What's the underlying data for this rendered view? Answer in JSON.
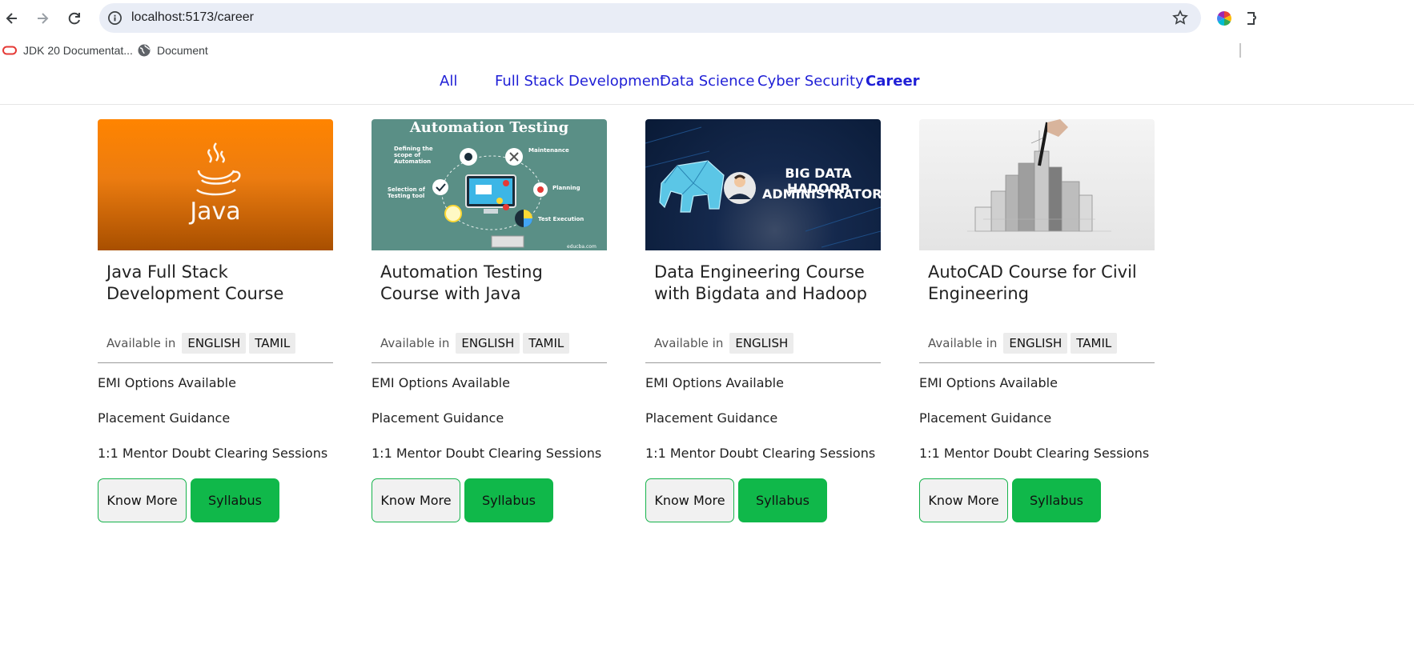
{
  "browser": {
    "url": "localhost:5173/career",
    "bookmarks": [
      {
        "label": "JDK 20 Documentat...",
        "icon": "oracle-icon"
      },
      {
        "label": "Document",
        "icon": "globe-icon"
      }
    ]
  },
  "nav": {
    "items": [
      {
        "label": "All",
        "active": false
      },
      {
        "label": "Full Stack Development",
        "active": false
      },
      {
        "label": "Data Science",
        "active": false
      },
      {
        "label": "Cyber Security",
        "active": false
      },
      {
        "label": "Career",
        "active": true
      }
    ],
    "link_color": "#1f1fd6"
  },
  "courses": [
    {
      "title": "Java Full Stack Development Course",
      "available_label": "Available in",
      "languages": [
        "ENGLISH",
        "TAMIL"
      ],
      "features": [
        "EMI Options Available",
        "Placement Guidance",
        "1:1 Mentor Doubt Clearing Sessions"
      ],
      "know_more": "Know More",
      "syllabus": "Syllabus",
      "image": {
        "brand_text": "Java",
        "icon": "java-logo-icon"
      }
    },
    {
      "title": "Automation Testing Course with Java",
      "available_label": "Available in",
      "languages": [
        "ENGLISH",
        "TAMIL"
      ],
      "features": [
        "EMI Options Available",
        "Placement Guidance",
        "1:1 Mentor Doubt Clearing Sessions"
      ],
      "know_more": "Know More",
      "syllabus": "Syllabus",
      "image": {
        "heading": "Automation Testing",
        "labels": [
          "Defining the scope of Automation",
          "Maintenance",
          "Selection of Testing tool",
          "Planning",
          "Test Execution"
        ],
        "credit": "educba.com"
      }
    },
    {
      "title": "Data Engineering Course with Bigdata and Hadoop",
      "available_label": "Available in",
      "languages": [
        "ENGLISH"
      ],
      "features": [
        "EMI Options Available",
        "Placement Guidance",
        "1:1 Mentor Doubt Clearing Sessions"
      ],
      "know_more": "Know More",
      "syllabus": "Syllabus",
      "image": {
        "line1": "BIG DATA HADOOP",
        "line2": "ADMINISTRATOR",
        "icon": "elephant-icon"
      }
    },
    {
      "title": "AutoCAD Course for Civil Engineering",
      "available_label": "Available in",
      "languages": [
        "ENGLISH",
        "TAMIL"
      ],
      "features": [
        "EMI Options Available",
        "Placement Guidance",
        "1:1 Mentor Doubt Clearing Sessions"
      ],
      "know_more": "Know More",
      "syllabus": "Syllabus",
      "image": {
        "icon": "city-sketch-icon"
      }
    }
  ],
  "colors": {
    "accent_green": "#10b84a",
    "java_orange": "#f57c00",
    "automation_teal": "#5a8f86",
    "hadoop_navy": "#0d2447"
  }
}
